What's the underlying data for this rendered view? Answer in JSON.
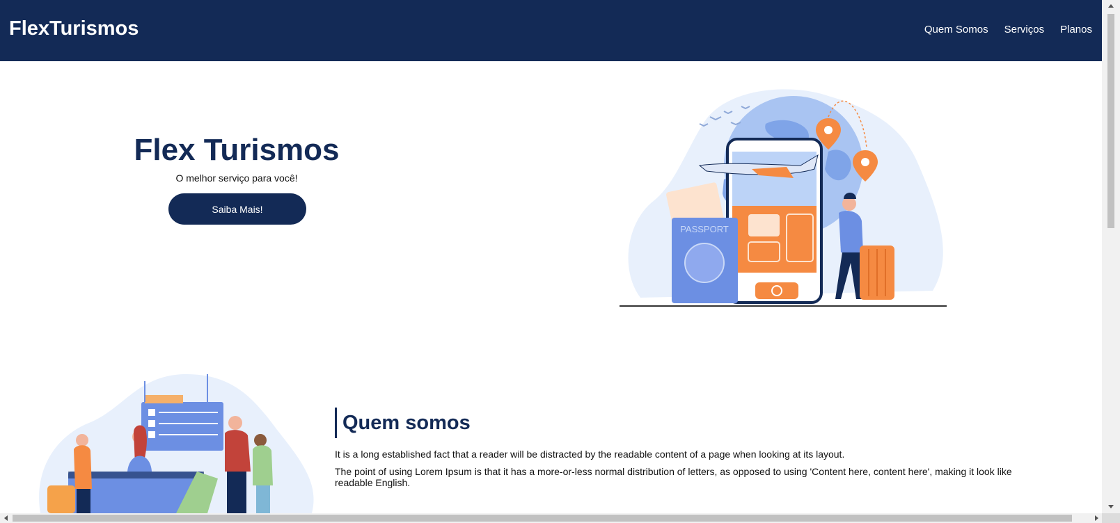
{
  "navbar": {
    "brand": "FlexTurismos",
    "links": [
      "Quem Somos",
      "Serviços",
      "Planos"
    ]
  },
  "hero": {
    "title": "Flex Turismos",
    "subtitle": "O melhor serviço para você!",
    "cta_label": "Saiba Mais!",
    "illustration": {
      "icon": "travel-illustration",
      "passport_label": "PASSPORT"
    }
  },
  "about": {
    "title": "Quem somos",
    "paragraphs": [
      "It is a long established fact that a reader will be distracted by the readable content of a page when looking at its layout.",
      "The point of using Lorem Ipsum is that it has a more-or-less normal distribution of letters, as opposed to using 'Content here, content here', making it look like readable English."
    ],
    "illustration": {
      "icon": "airport-checkin-illustration"
    }
  },
  "colors": {
    "primary": "#132a56",
    "accent": "#f58a42",
    "illustration_blue": "#6c8fe3",
    "illustration_light": "#e8f0fc"
  }
}
